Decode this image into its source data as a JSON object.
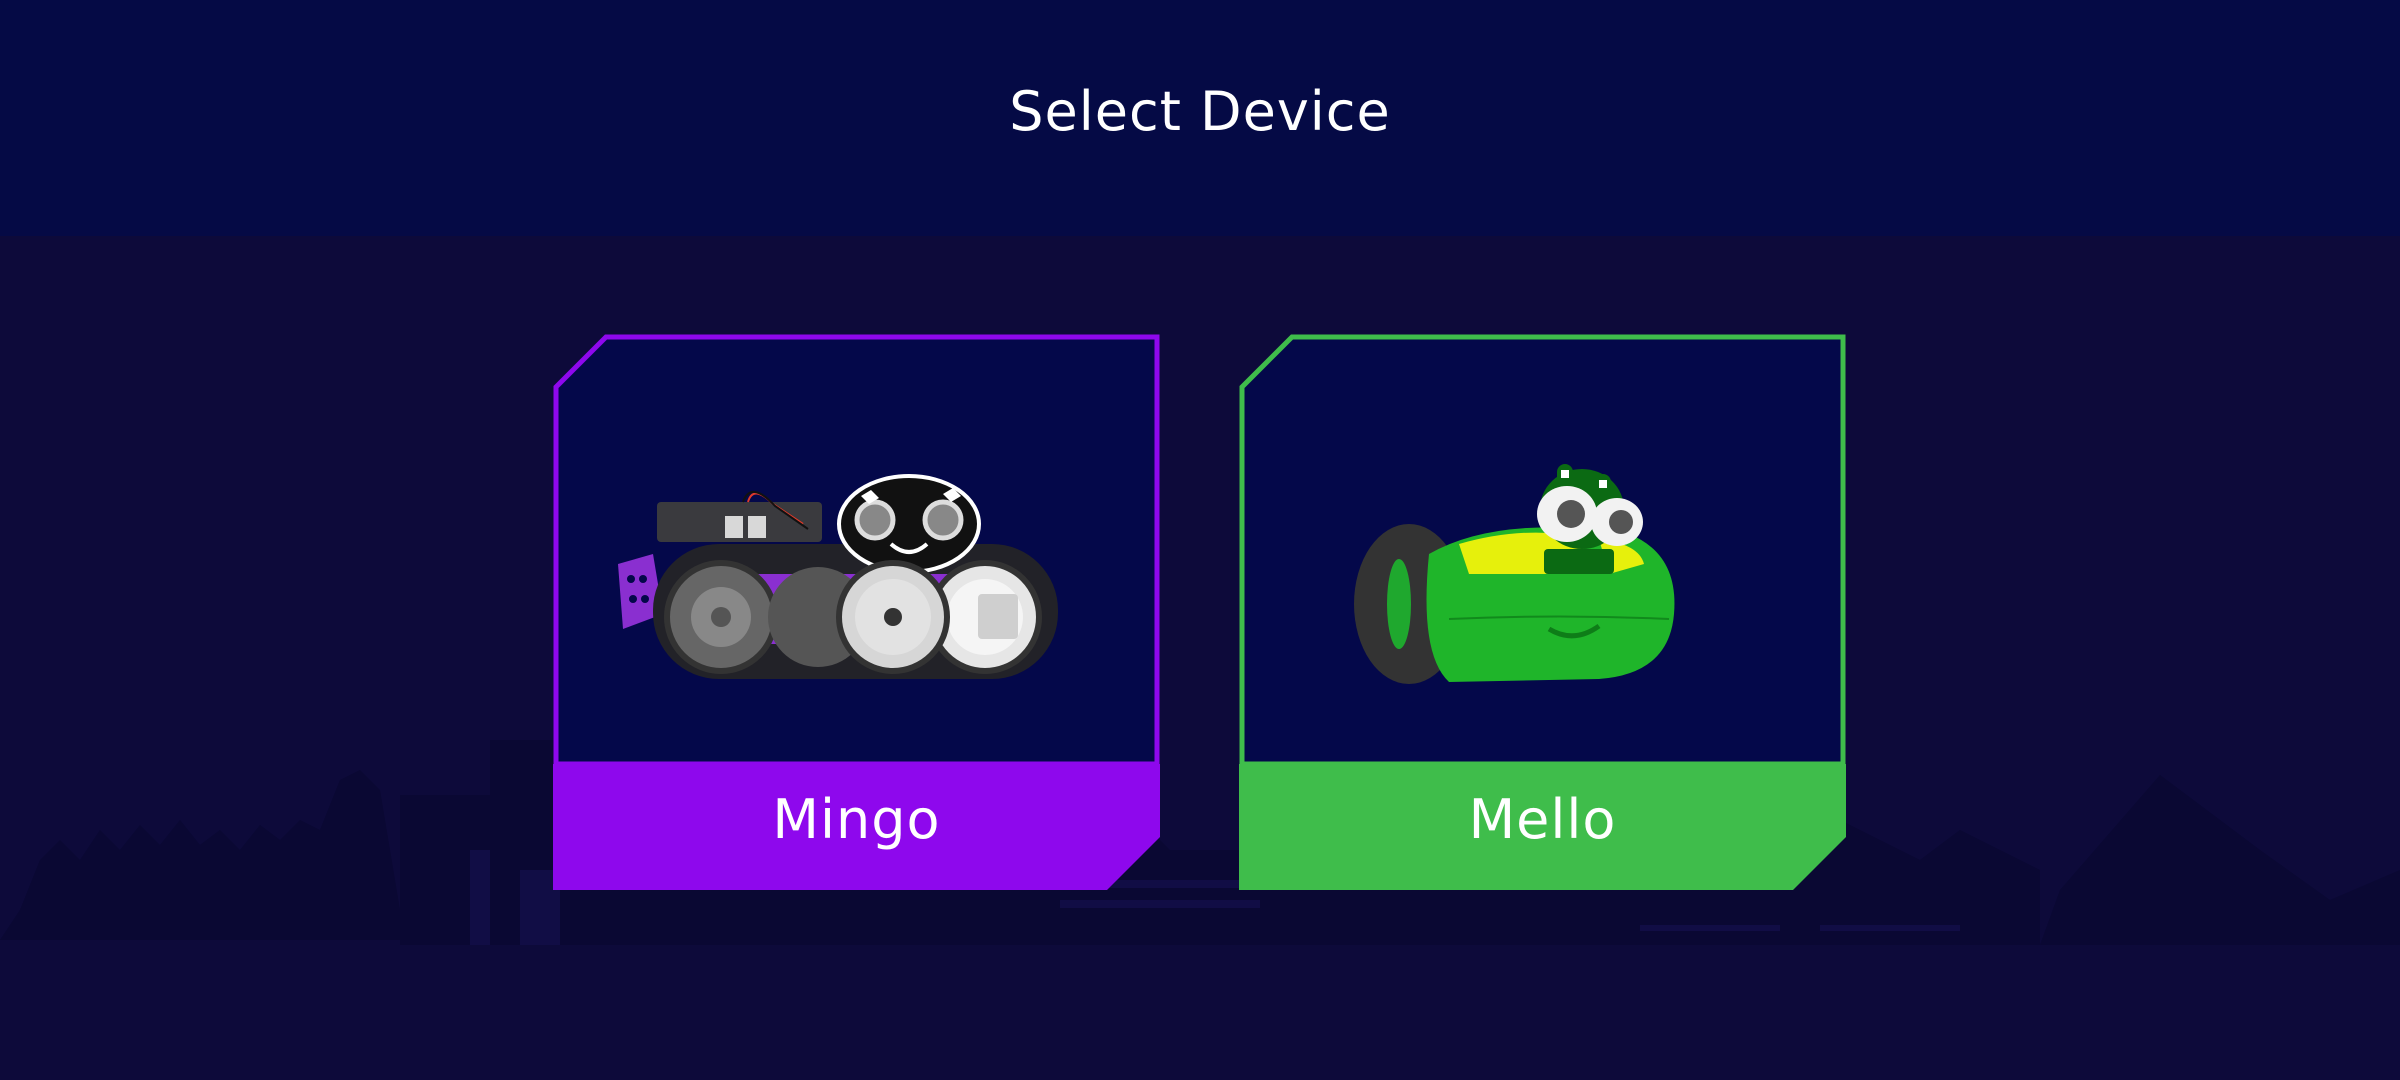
{
  "header": {
    "title": "Select Device"
  },
  "devices": [
    {
      "label": "Mingo",
      "accent": "#8e08ed",
      "icon": "mingo-robot-icon"
    },
    {
      "label": "Mello",
      "accent": "#3fbd4b",
      "icon": "mello-robot-icon"
    }
  ],
  "colors": {
    "header_bg": "#050a45",
    "page_bg": "#0d0a3a",
    "card_bg": "#04084a"
  }
}
